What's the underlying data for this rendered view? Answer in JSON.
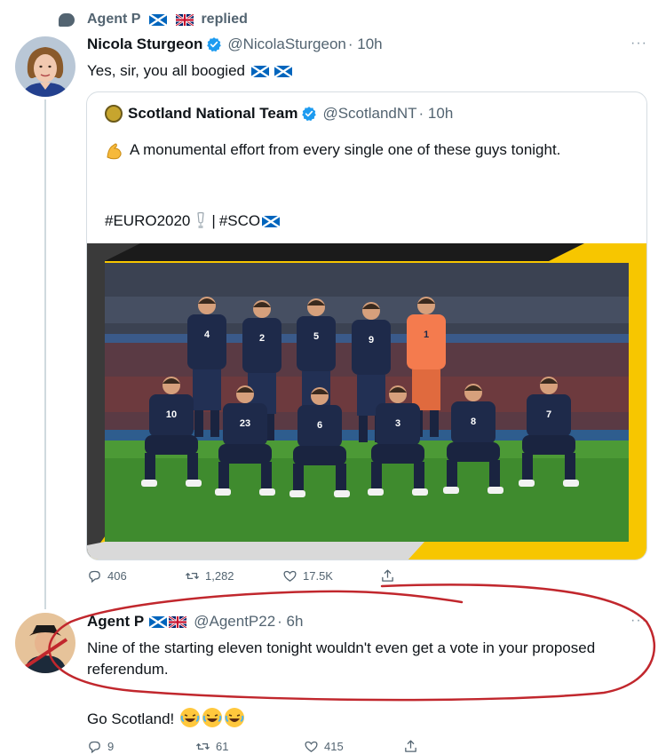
{
  "replied_banner": {
    "user": "Agent P",
    "action": "replied"
  },
  "tweet_main": {
    "name": "Nicola Sturgeon",
    "handle": "@NicolaSturgeon",
    "time": "· 10h",
    "text": "Yes, sir, you all boogied",
    "more": "···"
  },
  "quote": {
    "name": "Scotland National Team",
    "handle": "@ScotlandNT",
    "time": "· 10h",
    "text": "A monumental effort from every single one of these guys tonight.",
    "tag1": "#EURO2020",
    "separator": "|",
    "tag2": "#SCO",
    "shirt_numbers": [
      "4",
      "2",
      "5",
      "9",
      "1",
      "10",
      "23",
      "6",
      "3",
      "8",
      "7"
    ]
  },
  "main_actions": {
    "replies": "406",
    "retweets": "1,282",
    "likes": "17.5K"
  },
  "reply_tweet": {
    "name": "Agent P",
    "handle": "@AgentP22",
    "time": "· 6h",
    "text": "Nine of the starting eleven tonight wouldn't even get a vote in your proposed referendum.",
    "text2": "Go Scotland!",
    "more": "···"
  },
  "reply_actions": {
    "replies": "9",
    "retweets": "61",
    "likes": "415"
  },
  "colors": {
    "verified_blue": "#1d9bf0",
    "annotation_red": "#c1272d",
    "saltire_blue": "#0065bd",
    "photo_yellow": "#f7c600",
    "kit_navy": "#1e2a4a",
    "keeper_orange": "#f47b4e"
  },
  "icons": [
    "reply-icon",
    "retweet-icon",
    "like-icon",
    "share-icon",
    "verified-icon",
    "scotland-flag-icon",
    "uk-flag-icon",
    "flexed-biceps-icon",
    "trophy-icon",
    "laughing-icon"
  ]
}
